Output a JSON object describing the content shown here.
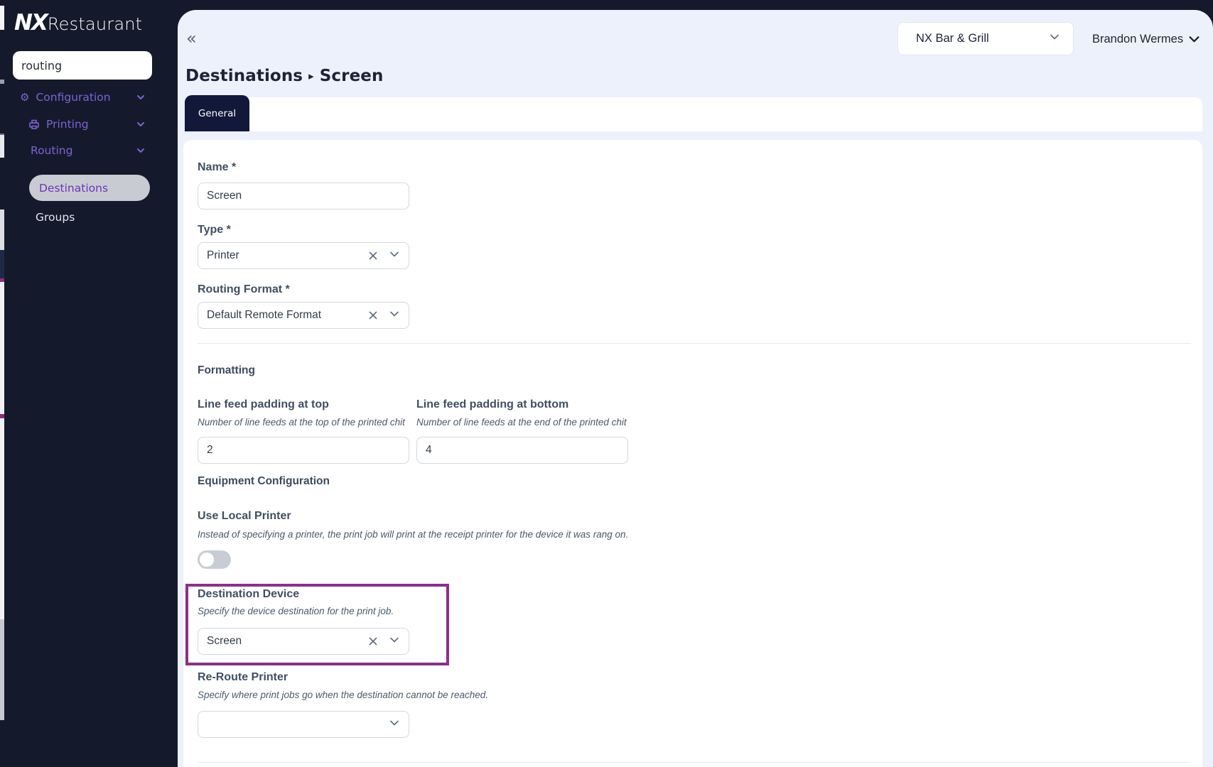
{
  "logo": {
    "nx": "NX",
    "restaurant": "Restaurant"
  },
  "sidebar": {
    "search_value": "routing",
    "items": [
      {
        "label": "Configuration"
      },
      {
        "label": "Printing"
      },
      {
        "label": "Routing"
      },
      {
        "label": "Destinations"
      },
      {
        "label": "Groups"
      }
    ]
  },
  "topbar": {
    "collapse": "«",
    "store": "NX Bar & Grill",
    "user": "Brandon Wermes"
  },
  "page": {
    "breadcrumb_parent": "Destinations",
    "breadcrumb_sep": "▸",
    "breadcrumb_current": "Screen",
    "tab": "General"
  },
  "form": {
    "name": {
      "label": "Name *",
      "value": "Screen"
    },
    "type": {
      "label": "Type *",
      "value": "Printer"
    },
    "routing_format": {
      "label": "Routing Format *",
      "value": "Default Remote Format"
    },
    "formatting_heading": "Formatting",
    "line_top": {
      "label": "Line feed padding at top",
      "help": "Number of line feeds at the top of the printed chit",
      "value": "2"
    },
    "line_bottom": {
      "label": "Line feed padding at bottom",
      "help": "Number of line feeds at the end of the printed chit",
      "value": "4"
    },
    "equipment_heading": "Equipment Configuration",
    "use_local": {
      "label": "Use Local Printer",
      "help": "Instead of specifying a printer, the print job will print at the receipt printer for the device it was rang on.",
      "enabled": false
    },
    "destination_device": {
      "label": "Destination Device",
      "help": "Specify the device destination for the print job.",
      "value": "Screen"
    },
    "reroute": {
      "label": "Re-Route Printer",
      "help": "Specify where print jobs go when the destination cannot be reached.",
      "value": ""
    }
  },
  "colors": {
    "sidebar_bg": "#141a2b",
    "panel_bg": "#edf1fb",
    "accent_purple": "#7e61d8",
    "active_pill_text": "#6b35bb",
    "tab_bg": "#111839",
    "highlight_border": "#8d2f88"
  }
}
